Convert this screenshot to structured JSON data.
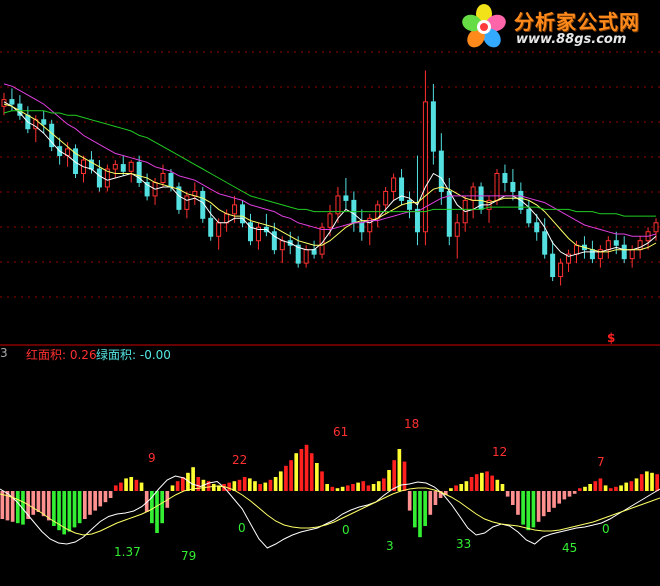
{
  "logo": {
    "title": "分析家公式网",
    "url": "www.88gs.com"
  },
  "indicator_header": {
    "left_fragment": "3",
    "red_area": "红面积: 0.26",
    "green_area": "绿面积: -0.00"
  },
  "marker": "$",
  "colors": {
    "up_candle": "#ff3030",
    "down_candle": "#54e0e0",
    "ma_white": "#ffffff",
    "ma_yellow": "#ffff66",
    "ma_magenta": "#e040e0",
    "ma_green": "#22cc22",
    "dotted_grid": "#9a0000",
    "bar_red": "#ff2020",
    "bar_yellow": "#ffff33",
    "bar_pink": "#ff9090",
    "bar_green": "#33ee33",
    "label_red": "#ff3030",
    "label_green": "#33ee33"
  },
  "chart_data": [
    {
      "type": "candlestick",
      "grid": "dotted horizontal",
      "legend": "none",
      "ylim": [
        0,
        100
      ],
      "ohlc": [
        [
          82,
          88,
          78,
          85
        ],
        [
          85,
          90,
          80,
          83
        ],
        [
          83,
          87,
          76,
          78
        ],
        [
          78,
          82,
          70,
          72
        ],
        [
          72,
          78,
          66,
          76
        ],
        [
          76,
          80,
          70,
          74
        ],
        [
          74,
          76,
          62,
          64
        ],
        [
          64,
          68,
          56,
          60
        ],
        [
          60,
          66,
          55,
          63
        ],
        [
          63,
          65,
          50,
          52
        ],
        [
          52,
          60,
          48,
          58
        ],
        [
          58,
          62,
          52,
          54
        ],
        [
          54,
          58,
          44,
          46
        ],
        [
          46,
          56,
          44,
          54
        ],
        [
          54,
          58,
          50,
          56
        ],
        [
          56,
          60,
          51,
          53
        ],
        [
          53,
          58,
          48,
          57
        ],
        [
          57,
          60,
          46,
          48
        ],
        [
          48,
          52,
          40,
          42
        ],
        [
          42,
          50,
          38,
          48
        ],
        [
          48,
          56,
          46,
          52
        ],
        [
          52,
          54,
          44,
          46
        ],
        [
          46,
          48,
          34,
          36
        ],
        [
          36,
          44,
          32,
          42
        ],
        [
          42,
          48,
          38,
          44
        ],
        [
          44,
          46,
          30,
          32
        ],
        [
          32,
          38,
          22,
          24
        ],
        [
          24,
          32,
          18,
          30
        ],
        [
          30,
          36,
          26,
          34
        ],
        [
          34,
          42,
          30,
          38
        ],
        [
          38,
          40,
          28,
          30
        ],
        [
          30,
          34,
          20,
          22
        ],
        [
          22,
          30,
          18,
          28
        ],
        [
          28,
          34,
          24,
          26
        ],
        [
          26,
          30,
          16,
          18
        ],
        [
          18,
          24,
          12,
          22
        ],
        [
          22,
          26,
          16,
          20
        ],
        [
          20,
          24,
          10,
          12
        ],
        [
          12,
          20,
          10,
          18
        ],
        [
          18,
          22,
          14,
          16
        ],
        [
          16,
          30,
          14,
          28
        ],
        [
          28,
          38,
          24,
          34
        ],
        [
          34,
          46,
          30,
          42
        ],
        [
          42,
          50,
          36,
          40
        ],
        [
          40,
          44,
          26,
          30
        ],
        [
          30,
          36,
          22,
          26
        ],
        [
          26,
          34,
          20,
          32
        ],
        [
          32,
          40,
          28,
          38
        ],
        [
          38,
          46,
          34,
          44
        ],
        [
          44,
          52,
          40,
          50
        ],
        [
          50,
          54,
          38,
          40
        ],
        [
          40,
          44,
          32,
          36
        ],
        [
          36,
          60,
          20,
          26
        ],
        [
          26,
          98,
          20,
          84
        ],
        [
          84,
          92,
          56,
          62
        ],
        [
          62,
          70,
          38,
          44
        ],
        [
          44,
          50,
          20,
          24
        ],
        [
          24,
          34,
          14,
          30
        ],
        [
          30,
          42,
          26,
          40
        ],
        [
          40,
          48,
          32,
          46
        ],
        [
          46,
          48,
          34,
          36
        ],
        [
          36,
          42,
          30,
          40
        ],
        [
          40,
          54,
          38,
          52
        ],
        [
          52,
          56,
          44,
          48
        ],
        [
          48,
          54,
          40,
          44
        ],
        [
          44,
          48,
          34,
          36
        ],
        [
          36,
          40,
          28,
          30
        ],
        [
          30,
          34,
          22,
          26
        ],
        [
          26,
          32,
          14,
          16
        ],
        [
          16,
          22,
          4,
          6
        ],
        [
          6,
          14,
          2,
          12
        ],
        [
          12,
          18,
          8,
          16
        ],
        [
          16,
          22,
          12,
          20
        ],
        [
          20,
          24,
          14,
          18
        ],
        [
          18,
          22,
          12,
          14
        ],
        [
          14,
          20,
          10,
          18
        ],
        [
          18,
          24,
          14,
          22
        ],
        [
          22,
          26,
          16,
          20
        ],
        [
          20,
          24,
          12,
          14
        ],
        [
          14,
          20,
          10,
          18
        ],
        [
          18,
          24,
          14,
          22
        ],
        [
          22,
          28,
          18,
          26
        ],
        [
          26,
          32,
          22,
          30
        ]
      ],
      "series": [
        {
          "name": "",
          "color_key": "ma_white",
          "values": [
            84,
            82,
            79,
            75,
            73,
            70,
            66,
            62,
            60,
            57,
            55,
            54,
            51,
            49,
            50,
            51,
            52,
            50,
            47,
            45,
            46,
            46,
            42,
            40,
            41,
            39,
            34,
            30,
            30,
            32,
            32,
            28,
            27,
            27,
            24,
            22,
            21,
            19,
            18,
            18,
            21,
            26,
            32,
            36,
            34,
            31,
            30,
            32,
            36,
            40,
            42,
            41,
            38,
            46,
            52,
            50,
            44,
            38,
            35,
            36,
            38,
            38,
            40,
            42,
            42,
            40,
            37,
            33,
            28,
            21,
            17,
            15,
            16,
            17,
            17,
            17,
            18,
            19,
            18,
            18,
            19,
            21,
            24
          ]
        },
        {
          "name": "",
          "color_key": "ma_yellow",
          "values": [
            83,
            82,
            80,
            78,
            76,
            73,
            70,
            67,
            64,
            61,
            59,
            57,
            55,
            53,
            52,
            52,
            52,
            51,
            50,
            48,
            47,
            46,
            45,
            43,
            42,
            41,
            39,
            36,
            34,
            33,
            33,
            31,
            30,
            29,
            28,
            26,
            24,
            22,
            21,
            20,
            20,
            22,
            25,
            28,
            30,
            31,
            31,
            32,
            34,
            36,
            38,
            39,
            39,
            42,
            45,
            46,
            45,
            43,
            41,
            40,
            40,
            39,
            40,
            41,
            41,
            41,
            40,
            38,
            35,
            31,
            27,
            23,
            20,
            19,
            18,
            17,
            17,
            18,
            18,
            18,
            18,
            19,
            21
          ]
        },
        {
          "name": "",
          "color_key": "ma_magenta",
          "values": [
            92,
            91,
            89,
            87,
            85,
            83,
            80,
            77,
            74,
            72,
            69,
            67,
            65,
            63,
            61,
            60,
            59,
            58,
            57,
            55,
            54,
            53,
            51,
            50,
            49,
            47,
            45,
            43,
            42,
            41,
            40,
            38,
            37,
            36,
            35,
            33,
            32,
            30,
            29,
            28,
            27,
            27,
            28,
            29,
            30,
            30,
            31,
            31,
            32,
            33,
            34,
            35,
            35,
            37,
            39,
            41,
            42,
            42,
            42,
            42,
            42,
            42,
            42,
            42,
            42,
            42,
            41,
            40,
            39,
            37,
            35,
            33,
            31,
            29,
            28,
            27,
            26,
            25,
            25,
            24,
            24,
            24,
            25
          ]
        },
        {
          "name": "",
          "color_key": "ma_green",
          "values": [
            79,
            80,
            80,
            80,
            80,
            80,
            79,
            79,
            78,
            78,
            77,
            76,
            75,
            74,
            73,
            72,
            71,
            69,
            68,
            66,
            64,
            62,
            60,
            58,
            56,
            54,
            52,
            50,
            48,
            46,
            44,
            42,
            41,
            40,
            39,
            38,
            37,
            36,
            36,
            35,
            35,
            35,
            35,
            35,
            35,
            35,
            35,
            35,
            35,
            35,
            35,
            35,
            35,
            35,
            36,
            36,
            36,
            36,
            36,
            36,
            36,
            37,
            37,
            37,
            37,
            37,
            37,
            37,
            36,
            36,
            36,
            36,
            35,
            35,
            35,
            34,
            34,
            34,
            33,
            33,
            33,
            33,
            33
          ]
        }
      ]
    },
    {
      "type": "bar",
      "legend": "none",
      "ylim": [
        -100,
        100
      ],
      "values": [
        -40,
        -42,
        -44,
        -46,
        -48,
        -40,
        -34,
        -30,
        -36,
        -42,
        -50,
        -56,
        -62,
        -58,
        -52,
        -46,
        -40,
        -34,
        -28,
        -22,
        -16,
        -10,
        8,
        12,
        18,
        20,
        16,
        12,
        -30,
        -46,
        -60,
        -46,
        -24,
        8,
        14,
        20,
        26,
        34,
        20,
        16,
        14,
        10,
        8,
        10,
        12,
        14,
        16,
        20,
        18,
        14,
        10,
        12,
        16,
        20,
        28,
        36,
        44,
        54,
        60,
        66,
        54,
        40,
        28,
        10,
        6,
        4,
        6,
        8,
        10,
        12,
        14,
        8,
        10,
        14,
        18,
        30,
        44,
        60,
        42,
        -28,
        -52,
        -66,
        -50,
        -34,
        -20,
        -10,
        -6,
        4,
        8,
        10,
        14,
        20,
        24,
        26,
        28,
        22,
        16,
        10,
        -8,
        -20,
        -34,
        -48,
        -56,
        -52,
        -44,
        -36,
        -30,
        -24,
        -18,
        -12,
        -8,
        -4,
        4,
        6,
        10,
        14,
        18,
        8,
        4,
        6,
        8,
        12,
        14,
        18,
        24,
        28,
        26,
        24
      ]
    },
    {
      "type": "line",
      "legend": "none",
      "ylim": [
        -100,
        100
      ],
      "series": [
        {
          "name": "",
          "color_key": "ma_white",
          "values": [
            30,
            20,
            5,
            -15,
            -35,
            -55,
            -70,
            -78,
            -80,
            -76,
            -66,
            -50,
            -35,
            -25,
            -20,
            -18,
            -14,
            -5,
            10,
            30,
            48,
            56,
            52,
            40,
            35,
            42,
            45,
            30,
            10,
            -10,
            -40,
            -70,
            -88,
            -80,
            -70,
            -62,
            -56,
            -52,
            -48,
            -40,
            -32,
            -20,
            -12,
            -6,
            -2,
            4,
            18,
            30,
            38,
            40,
            44,
            42,
            34,
            20,
            0,
            -24,
            -48,
            -62,
            -58,
            -46,
            -40,
            -44,
            -56,
            -72,
            -80,
            -66,
            -60,
            -56,
            -52,
            -48,
            -46,
            -42,
            -38,
            -30,
            -20,
            -10,
            0,
            10,
            20,
            30
          ]
        },
        {
          "name": "",
          "color_key": "ma_yellow",
          "values": [
            20,
            16,
            10,
            2,
            -8,
            -18,
            -30,
            -40,
            -50,
            -58,
            -62,
            -60,
            -54,
            -46,
            -38,
            -32,
            -26,
            -20,
            -12,
            -2,
            8,
            18,
            26,
            30,
            32,
            34,
            36,
            34,
            28,
            18,
            6,
            -8,
            -22,
            -34,
            -42,
            -46,
            -48,
            -48,
            -46,
            -42,
            -36,
            -28,
            -20,
            -12,
            -4,
            4,
            12,
            20,
            26,
            30,
            32,
            32,
            28,
            22,
            14,
            4,
            -8,
            -20,
            -30,
            -36,
            -40,
            -42,
            -44,
            -48,
            -52,
            -54,
            -54,
            -52,
            -48,
            -44,
            -40,
            -36,
            -30,
            -24,
            -18,
            -12,
            -6,
            0,
            6,
            12
          ]
        }
      ],
      "annotations": [
        {
          "text": "9",
          "color_key": "label_red"
        },
        {
          "text": "22",
          "color_key": "label_red"
        },
        {
          "text": "61",
          "color_key": "label_red"
        },
        {
          "text": "18",
          "color_key": "label_red"
        },
        {
          "text": "12",
          "color_key": "label_red"
        },
        {
          "text": "7",
          "color_key": "label_red"
        },
        {
          "text": "0",
          "color_key": "label_green"
        },
        {
          "text": "0",
          "color_key": "label_green"
        },
        {
          "text": "3",
          "color_key": "label_green"
        },
        {
          "text": "33",
          "color_key": "label_green"
        },
        {
          "text": "45",
          "color_key": "label_green"
        },
        {
          "text": "0",
          "color_key": "label_green"
        },
        {
          "text": "1.37",
          "color_key": "label_green"
        },
        {
          "text": "79",
          "color_key": "label_green"
        }
      ]
    }
  ]
}
